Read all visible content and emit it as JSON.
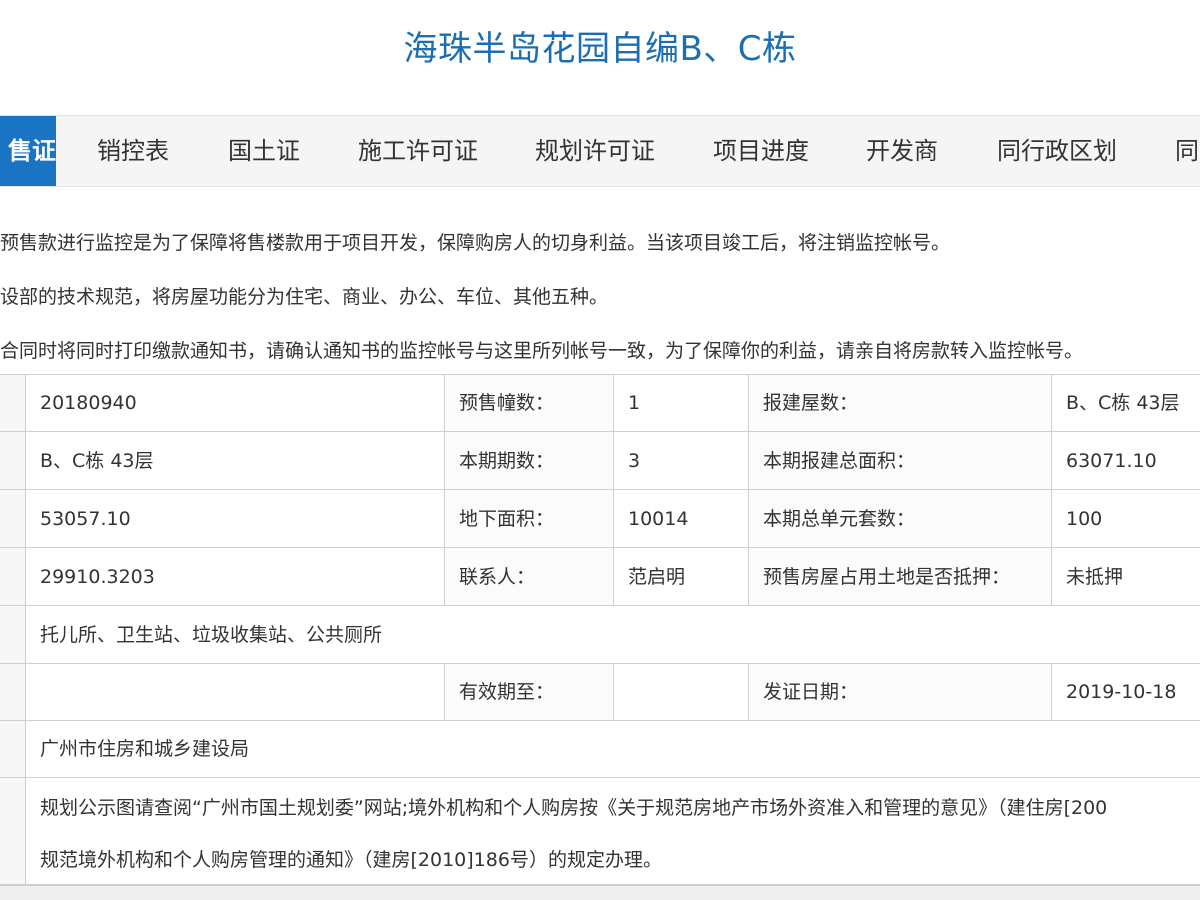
{
  "page": {
    "title": "海珠半岛花园自编B、C栋"
  },
  "tabs": [
    {
      "label": "售证",
      "active": true
    },
    {
      "label": "销控表",
      "active": false
    },
    {
      "label": "国土证",
      "active": false
    },
    {
      "label": "施工许可证",
      "active": false
    },
    {
      "label": "规划许可证",
      "active": false
    },
    {
      "label": "项目进度",
      "active": false
    },
    {
      "label": "开发商",
      "active": false
    },
    {
      "label": "同行政区划",
      "active": false
    },
    {
      "label": "同",
      "active": false
    }
  ],
  "notes": [
    "预售款进行监控是为了保障将售楼款用于项目开发，保障购房人的切身利益。当该项目竣工后，将注销监控帐号。",
    "设部的技术规范，将房屋功能分为住宅、商业、办公、车位、其他五种。",
    "合同时将同时打印缴款通知书，请确认通知书的监控帐号与这里所列帐号一致，为了保障你的利益，请亲自将房款转入监控帐号。"
  ],
  "table": {
    "rows": [
      {
        "c1": "20180940",
        "l2": "预售幢数：",
        "v2": "1",
        "l3": "报建屋数：",
        "v3": "B、C栋 43层"
      },
      {
        "c1": "B、C栋 43层",
        "l2": "本期期数：",
        "v2": "3",
        "l3": "本期报建总面积：",
        "v3": "63071.10"
      },
      {
        "c1": "53057.10",
        "l2": "地下面积：",
        "v2": "10014",
        "l3": "本期总单元套数：",
        "v3": "100"
      },
      {
        "c1": "29910.3203",
        "l2": "联系人：",
        "v2": "范启明",
        "l3": "预售房屋占用土地是否抵押：",
        "v3": "未抵押"
      }
    ],
    "facilities": "托儿所、卫生站、垃圾收集站、公共厕所",
    "validity": {
      "c1": "",
      "l2": "有效期至：",
      "v2": "",
      "l3": "发证日期：",
      "v3": "2019-10-18"
    },
    "authority": "广州市住房和城乡建设局",
    "remark_line1": "规划公示图请查阅“广州市国土规划委”网站;境外机构和个人购房按《关于规范房地产市场外资准入和管理的意见》（建住房[200",
    "remark_line2": "规范境外机构和个人购房管理的通知》（建房[2010]186号）的规定办理。"
  }
}
